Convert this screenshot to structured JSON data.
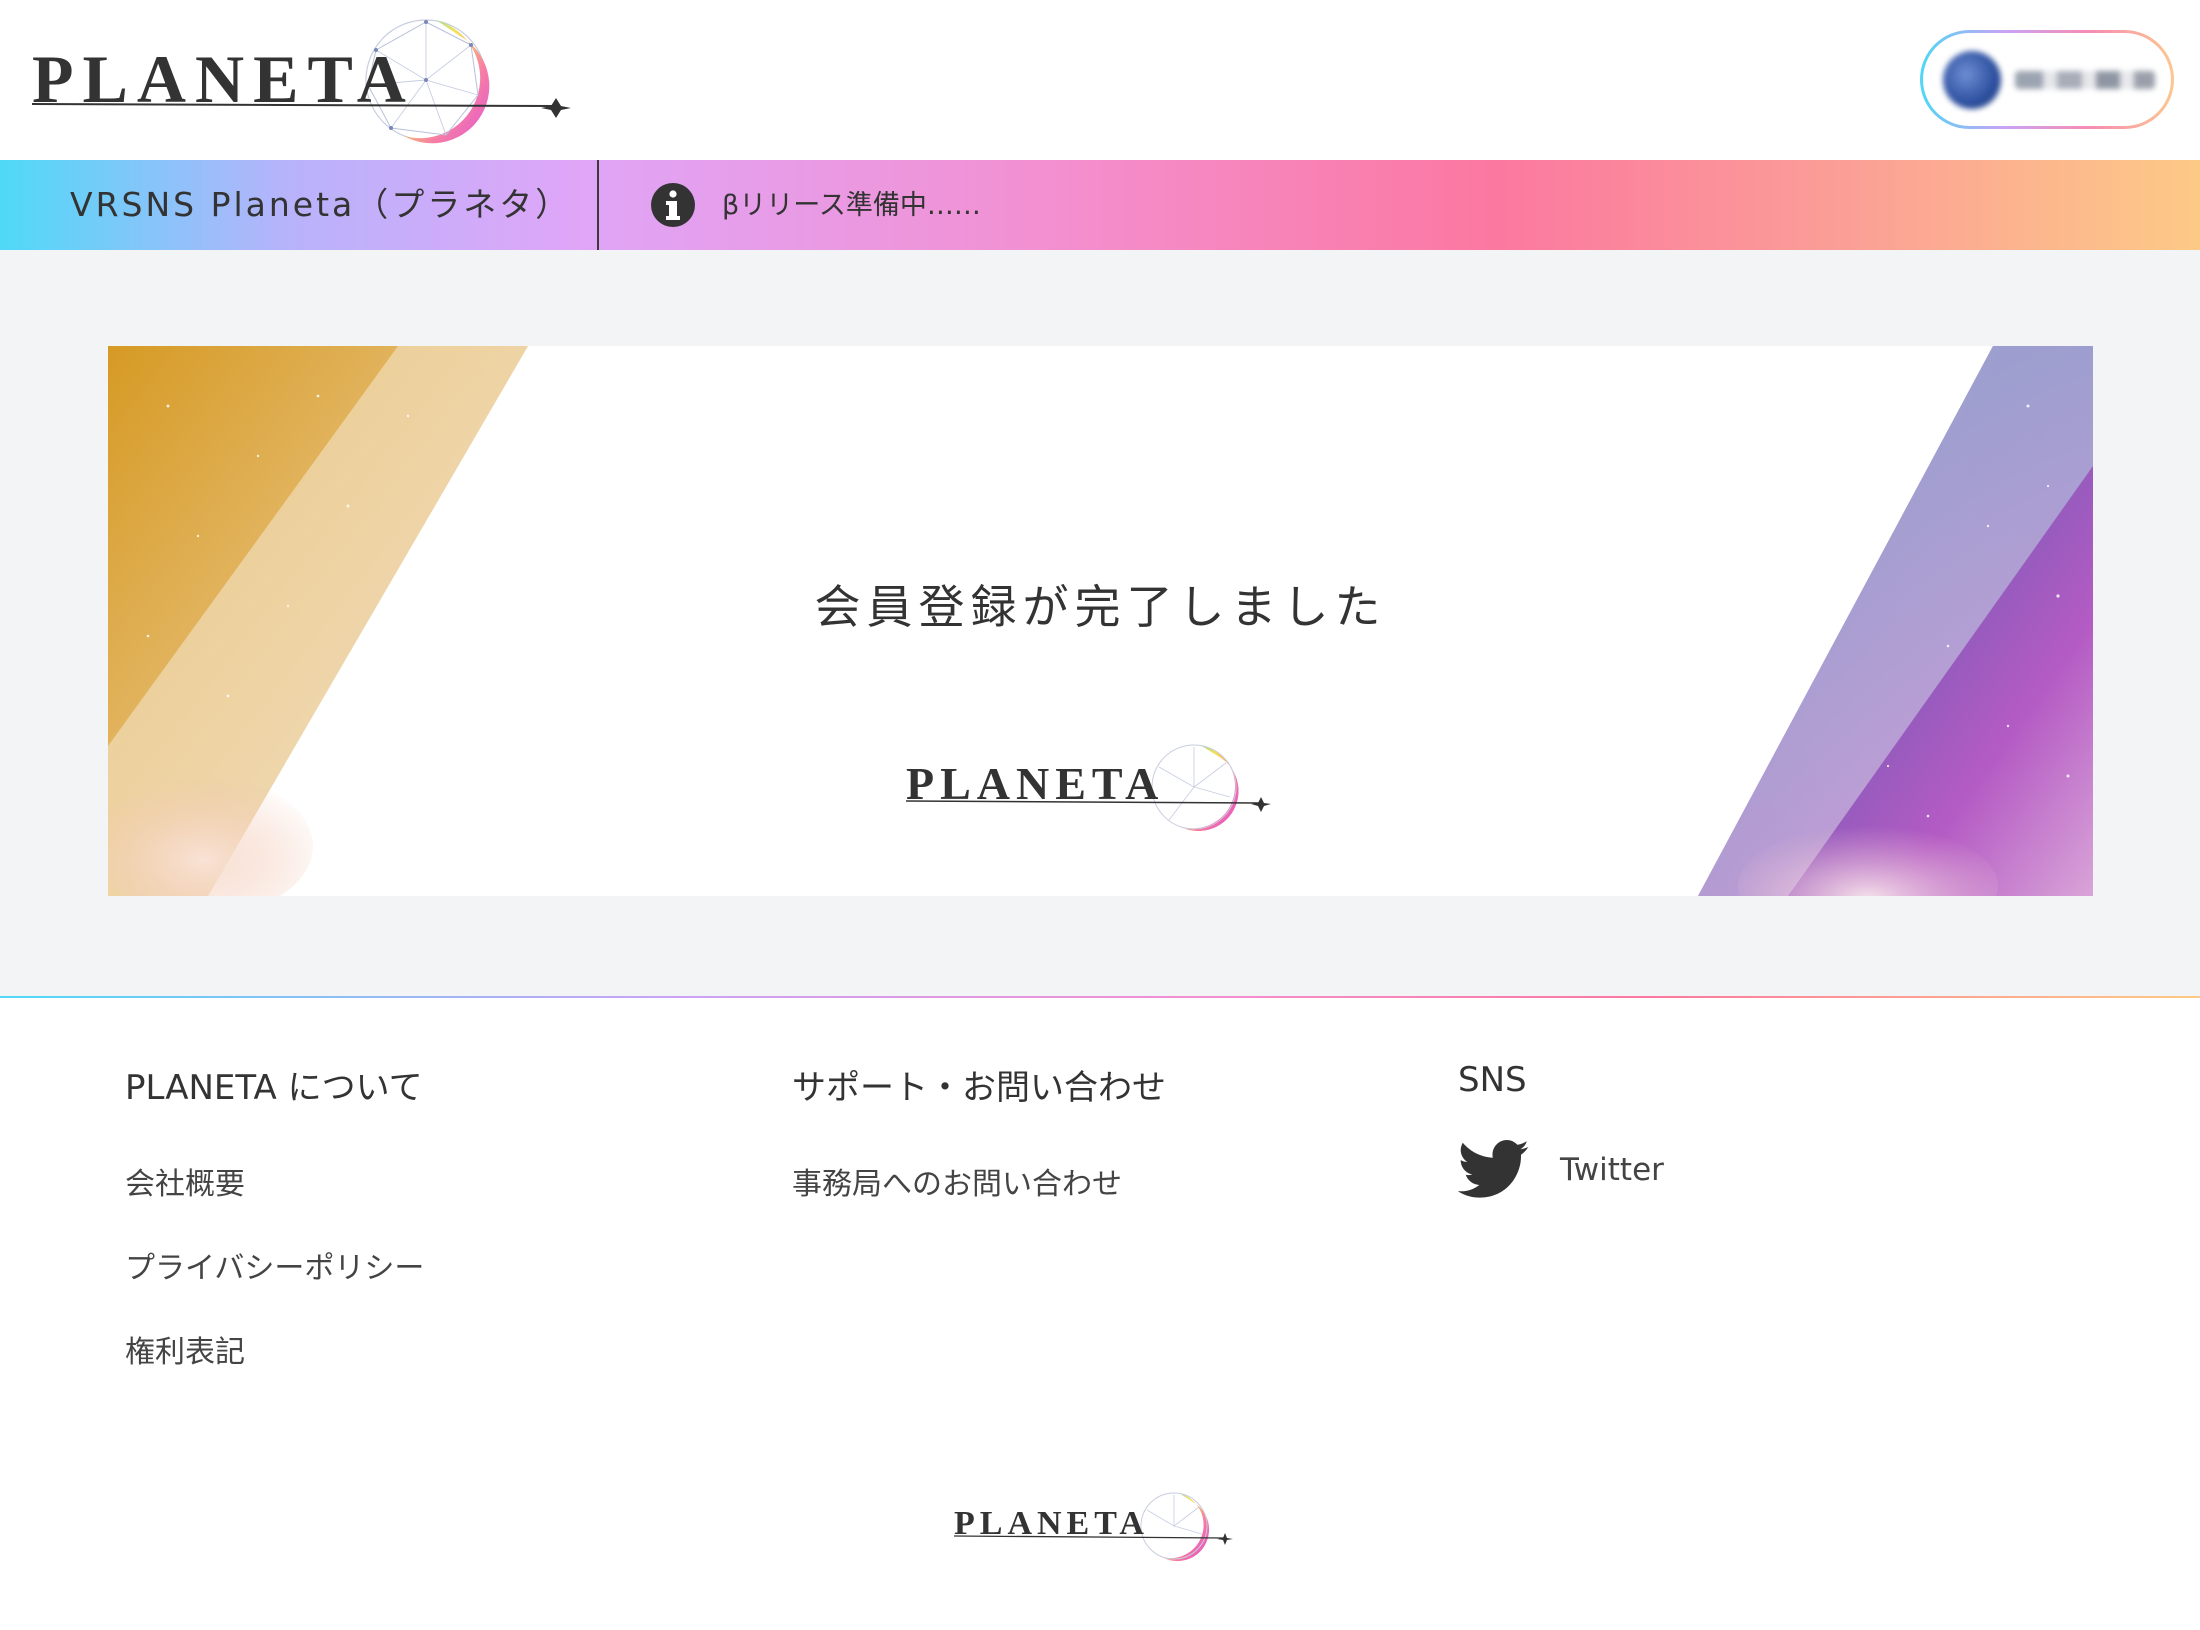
{
  "header": {
    "logo_text": "PLANETA"
  },
  "bar": {
    "site_title": "VRSNS Planeta（プラネタ）",
    "notice": "βリリース準備中……",
    "notice_icon": "info-circle-icon"
  },
  "banner": {
    "message": "会員登録が完了しました",
    "logo_text": "PLANETA"
  },
  "footer": {
    "about": {
      "heading": "PLANETA について",
      "links": [
        "会社概要",
        "プライバシーポリシー",
        "権利表記"
      ]
    },
    "support": {
      "heading": "サポート・お問い合わせ",
      "links": [
        "事務局へのお問い合わせ"
      ]
    },
    "sns": {
      "heading": "SNS",
      "twitter_label": "Twitter",
      "twitter_icon": "twitter-bird-icon"
    },
    "logo_text": "PLANETA"
  },
  "colors": {
    "gradient": [
      "#4fd9f7",
      "#b7b3fb",
      "#dfa6f8",
      "#f38fd0",
      "#fb78a0",
      "#fdca86"
    ],
    "main_bg": "#f3f4f6",
    "text": "#333333"
  }
}
